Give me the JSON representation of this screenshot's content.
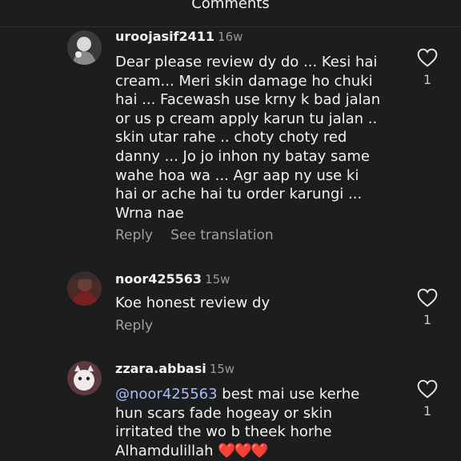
{
  "header": {
    "title": "Comments"
  },
  "comments": [
    {
      "username": "uroojasif2411",
      "time": "16w",
      "text": "Dear please review dy do ... Kesi hai\ncream... Meri skin damage ho chuki\nhai ... Facewash use krny k bad jalan\nor us p cream apply karun tu jalan ..\nskin utar rahe .. choty choty red\ndanny ... Jo jo inhon ny batay same\nwahe hoa wa ... Agr aap ny use ki\nhai or ache hai tu order karungi ...\nWrna nae",
      "reply": "Reply",
      "translate": "See translation",
      "likes": "1"
    },
    {
      "username": "noor425563",
      "time": "15w",
      "text": "Koe honest review dy",
      "reply": "Reply",
      "likes": "1"
    },
    {
      "username": "zzara.abbasi",
      "time": "15w",
      "mention": "@noor425563",
      "text": " best mai use kerhe\nhun scars fade hogeay or skin\nirritated the wo b theek horhe\nAlhamdulillah ",
      "hearts": "❤️❤️❤️",
      "likes": "1"
    }
  ],
  "icons": {
    "like": "heart-outline-icon"
  },
  "colors": {
    "background": "#1c1d1f",
    "mention": "#a9bef5",
    "heart": "#e3233a"
  }
}
